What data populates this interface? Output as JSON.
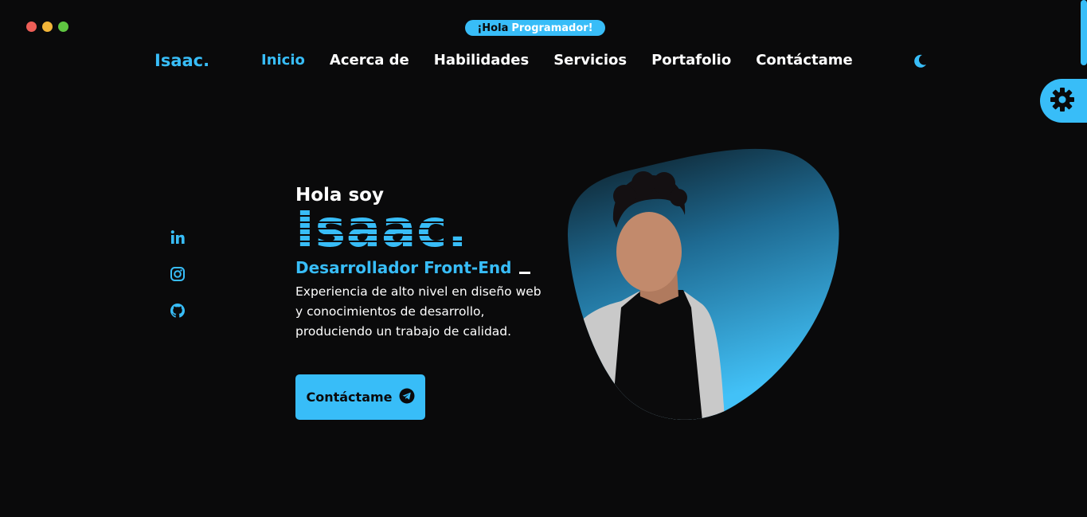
{
  "window": {
    "controls": [
      "close",
      "minimize",
      "maximize"
    ]
  },
  "greeting": {
    "prefix": "¡Hola",
    "accent": "Programador!"
  },
  "header": {
    "logo": "Isaac.",
    "nav": [
      {
        "label": "Inicio",
        "active": true
      },
      {
        "label": "Acerca de",
        "active": false
      },
      {
        "label": "Habilidades",
        "active": false
      },
      {
        "label": "Servicios",
        "active": false
      },
      {
        "label": "Portafolio",
        "active": false
      },
      {
        "label": "Contáctame",
        "active": false
      }
    ],
    "theme_toggle_icon": "moon-icon",
    "settings_icon": "gear-icon"
  },
  "social": [
    "linkedin-icon",
    "instagram-icon",
    "github-icon"
  ],
  "hero": {
    "greeting": "Hola soy",
    "name": "Isaac.",
    "role": "Desarrollador Front-End",
    "description": "Experiencia de alto nivel en diseño web y conocimientos de desarrollo, produciendo un trabajo de calidad.",
    "cta_label": "Contáctame",
    "cta_icon": "telegram-icon"
  },
  "colors": {
    "accent": "#38bdf8",
    "background": "#0a0a0b",
    "text": "#ffffff"
  }
}
